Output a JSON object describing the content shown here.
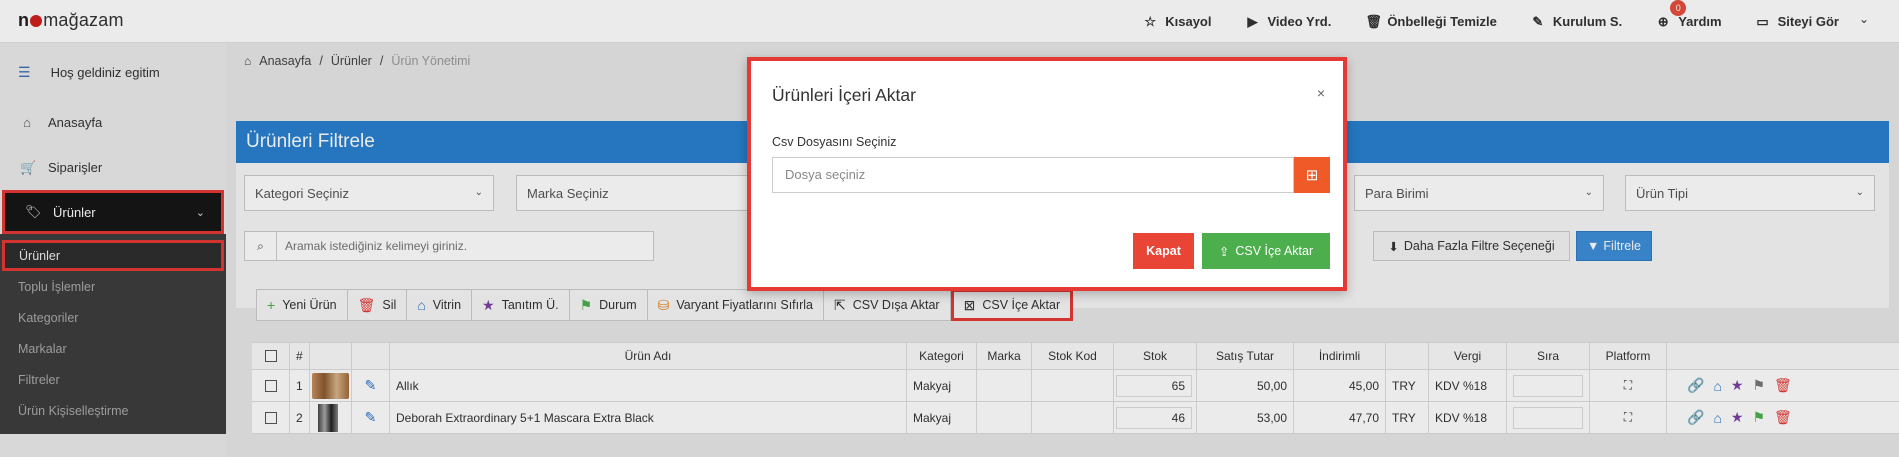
{
  "header": {
    "logo_pre": "n",
    "logo_post": "mağazam",
    "nav": [
      {
        "icon": "☆",
        "label": "Kısayol"
      },
      {
        "icon": "▶",
        "label": "Video Yrd."
      },
      {
        "icon": "🗑",
        "label": "Önbelleği Temizle"
      },
      {
        "icon": "✎",
        "label": "Kurulum S."
      },
      {
        "icon": "⊕",
        "label": "Yardım",
        "badge": "0"
      },
      {
        "icon": "▭",
        "label": "Siteyi Gör"
      }
    ],
    "chevron": "⌄"
  },
  "sidebar": {
    "welcome": "Hoş geldiniz egitim",
    "items": [
      {
        "icon": "⌂",
        "label": "Anasayfa"
      },
      {
        "icon": "🛒",
        "label": "Siparişler"
      },
      {
        "icon": "🏷",
        "label": "Ürünler"
      }
    ],
    "submenu": [
      "Ürünler",
      "Toplu İşlemler",
      "Kategoriler",
      "Markalar",
      "Filtreler",
      "Ürün Kişiselleştirme"
    ]
  },
  "breadcrumb": [
    "Anasayfa",
    "Ürünler",
    "Ürün Yönetimi"
  ],
  "filter": {
    "title": "Ürünleri Filtrele",
    "selects": [
      "Kategori Seçiniz",
      "Marka Seçiniz",
      "Para Birimi",
      "Ürün Tipi"
    ],
    "search_placeholder": "Aramak istediğiniz kelimeyi giriniz.",
    "more_label": "Daha Fazla Filtre Seçeneği",
    "filter_label": "Filtrele"
  },
  "toolbar": [
    {
      "icon": "+",
      "label": "Yeni Ürün",
      "color": "#4cae4c"
    },
    {
      "icon": "🗑",
      "label": "Sil",
      "color": "#e53935"
    },
    {
      "icon": "⌂",
      "label": "Vitrin",
      "color": "#2e74c6"
    },
    {
      "icon": "★",
      "label": "Tanıtım Ü.",
      "color": "#7b3fa0"
    },
    {
      "icon": "⚑",
      "label": "Durum",
      "color": "#4cae4c"
    },
    {
      "icon": "⛁",
      "label": "Varyant Fiyatlarını Sıfırla",
      "color": "#e08a2e"
    },
    {
      "icon": "⇱",
      "label": "CSV Dışa Aktar",
      "color": "#333333"
    },
    {
      "icon": "⊠",
      "label": "CSV İçe Aktar",
      "color": "#333333"
    }
  ],
  "table": {
    "headers": [
      "#",
      "Ürün Adı",
      "Kategori",
      "Marka",
      "Stok Kod",
      "Stok",
      "Satış Tutar",
      "İndirimli",
      "Vergi",
      "Sıra",
      "Platform"
    ],
    "rows": [
      {
        "no": "1",
        "name": "Allık",
        "category": "Makyaj",
        "brand": "",
        "code": "",
        "stock": "65",
        "price": "50,00",
        "discount": "45,00",
        "currency": "TRY",
        "tax": "KDV %18",
        "flag_color": "#777777"
      },
      {
        "no": "2",
        "name": "Deborah Extraordinary 5+1 Mascara Extra Black",
        "category": "Makyaj",
        "brand": "",
        "code": "",
        "stock": "46",
        "price": "53,00",
        "discount": "47,70",
        "currency": "TRY",
        "tax": "KDV %18",
        "flag_color": "#4cae4c"
      }
    ]
  },
  "modal": {
    "title": "Ürünleri İçeri Aktar",
    "close_icon": "×",
    "label": "Csv Dosyasını Seçiniz",
    "file_placeholder": "Dosya seçiniz",
    "cancel_label": "Kapat",
    "import_label": "CSV İçe Aktar"
  }
}
